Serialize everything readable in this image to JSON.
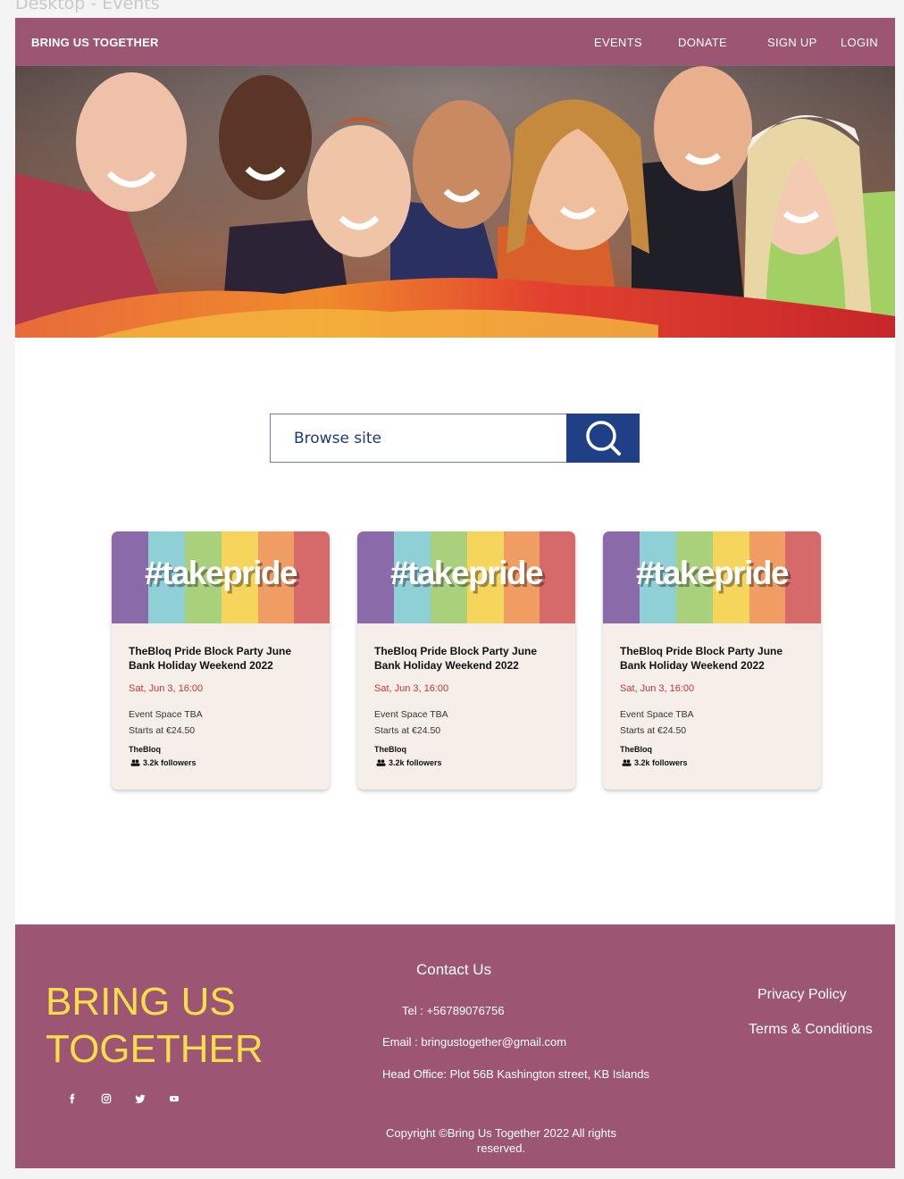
{
  "frame_label": "Desktop - Events",
  "nav": {
    "brand": "BRING US TOGETHER",
    "links": [
      {
        "label": "EVENTS"
      },
      {
        "label": "DONATE"
      },
      {
        "label": "SIGN UP"
      },
      {
        "label": "LOGIN"
      }
    ]
  },
  "search": {
    "placeholder": "Browse site"
  },
  "cards": [
    {
      "image_text": "#takepride",
      "title": "TheBloq Pride Block Party June Bank Holiday Weekend 2022",
      "date": "Sat, Jun 3, 16:00",
      "venue": "Event Space TBA",
      "price": "Starts at €24.50",
      "organizer": "TheBloq",
      "followers": "3.2k followers"
    },
    {
      "image_text": "#takepride",
      "title": "TheBloq Pride Block Party June Bank Holiday Weekend 2022",
      "date": "Sat, Jun 3, 16:00",
      "venue": "Event Space TBA",
      "price": "Starts at €24.50",
      "organizer": "TheBloq",
      "followers": "3.2k followers"
    },
    {
      "image_text": "#takepride",
      "title": "TheBloq Pride Block Party June Bank Holiday Weekend 2022",
      "date": "Sat, Jun 3, 16:00",
      "venue": "Event Space TBA",
      "price": "Starts at €24.50",
      "organizer": "TheBloq",
      "followers": "3.2k followers"
    }
  ],
  "colors": {
    "brand": "#9d5574",
    "footer_title": "#f6de4b",
    "search_button": "#1f3f87",
    "date": "#c0392b",
    "card_bg": "#f6eee9",
    "pride_stripes": [
      "#8a6aa8",
      "#8fd0d7",
      "#a9d17b",
      "#f5d55c",
      "#ef9d63",
      "#d66a6a"
    ]
  },
  "footer": {
    "brand_line1": "BRING US",
    "brand_line2": "TOGETHER",
    "social_icons": [
      "facebook-icon",
      "instagram-icon",
      "twitter-icon",
      "youtube-icon"
    ],
    "contact_title": "Contact Us",
    "tel": "Tel : +56789076756",
    "email": "Email : bringustogether@gmail.com",
    "office": "Head Office:  Plot 56B Kashington street, KB Islands",
    "copyright": "Copyright ©Bring Us Together 2022 All rights reserved.",
    "privacy": "Privacy Policy",
    "terms": "Terms & Conditions"
  }
}
